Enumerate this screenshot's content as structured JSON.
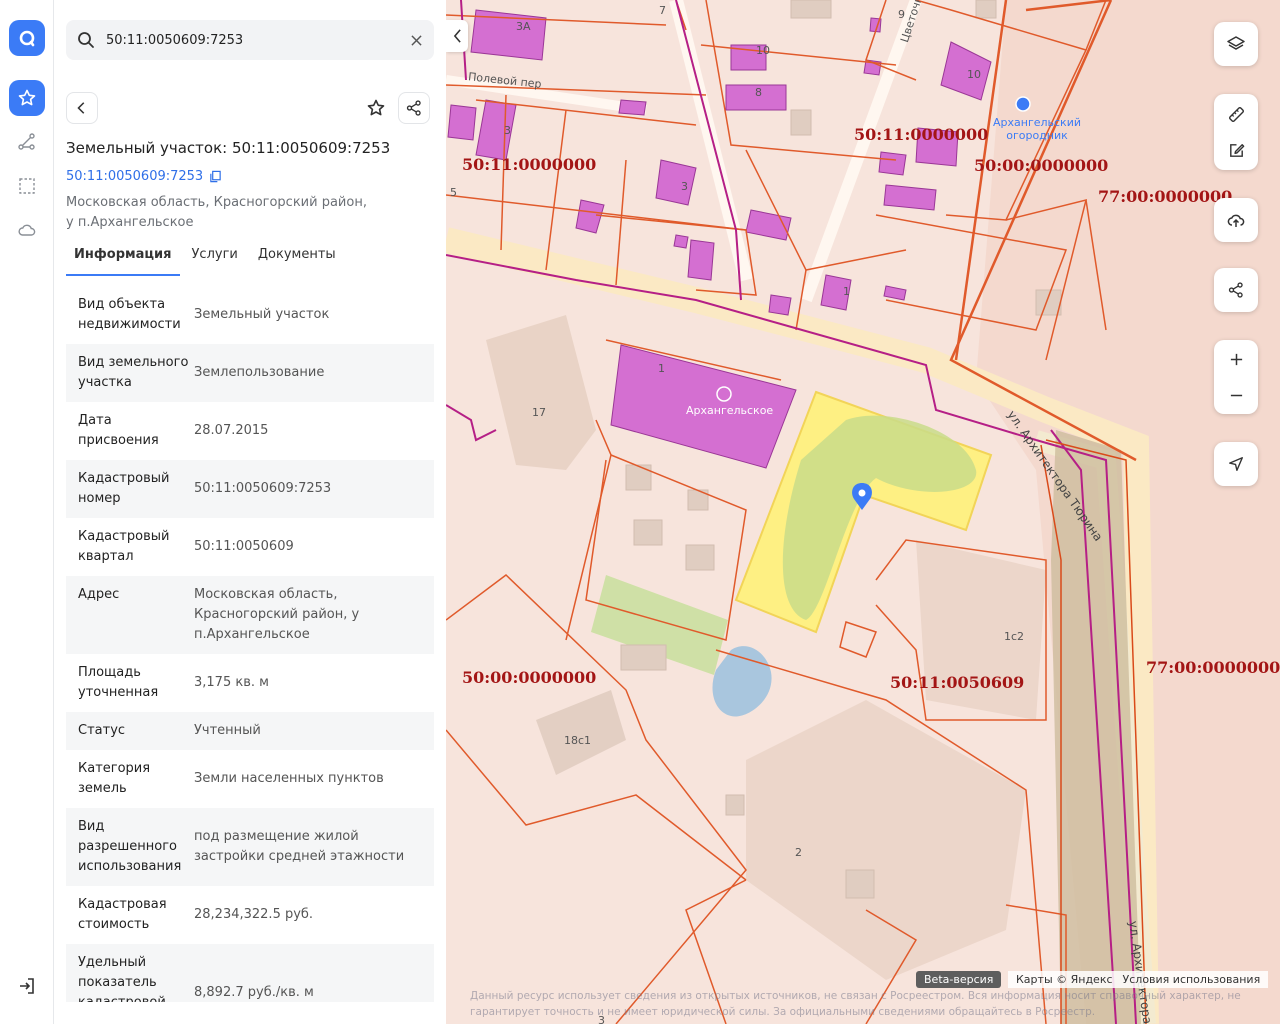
{
  "search": {
    "value": "50:11:0050609:7253"
  },
  "object": {
    "title": "Земельный участок: 50:11:0050609:7253",
    "cadastral_link": "50:11:0050609:7253",
    "address_sub": "Московская область, Красногорский район, у п.Архангельское"
  },
  "tabs": [
    "Информация",
    "Услуги",
    "Документы"
  ],
  "info": [
    {
      "k": "Вид объекта недвижимости",
      "v": "Земельный участок"
    },
    {
      "k": "Вид земельного участка",
      "v": "Землепользование"
    },
    {
      "k": "Дата присвоения",
      "v": "28.07.2015"
    },
    {
      "k": "Кадастровый номер",
      "v": "50:11:0050609:7253"
    },
    {
      "k": "Кадастровый квартал",
      "v": "50:11:0050609"
    },
    {
      "k": "Адрес",
      "v": "Московская область, Красногорский район, у п.Архангельское"
    },
    {
      "k": "Площадь уточненная",
      "v": "3,175 кв. м"
    },
    {
      "k": "Статус",
      "v": "Учтенный"
    },
    {
      "k": "Категория земель",
      "v": "Земли населенных пунктов"
    },
    {
      "k": "Вид разрешенного использования",
      "v": "под размещение жилой застройки средней этажности"
    },
    {
      "k": "Кадастровая стоимость",
      "v": "28,234,322.5 руб."
    },
    {
      "k": "Удельный показатель кадастровой стоимости",
      "v": "8,892.7 руб./кв. м"
    }
  ],
  "map": {
    "zones": [
      "50:11:0000000",
      "50:11:0000000",
      "50:00:0000000",
      "77:00:0000000",
      "50:00:0000000",
      "50:11:0050609",
      "77:00:0000000"
    ],
    "streets": [
      "Полевой пер",
      "Цветочная ул.",
      "ул. Архитектора Тюрина",
      "ул. Архитектора"
    ],
    "poi": [
      "Архангельский огородник",
      "Архангельское"
    ],
    "house_numbers": [
      "3А",
      "7",
      "9",
      "10",
      "8",
      "10",
      "3",
      "3",
      "5",
      "1",
      "1",
      "17",
      "1с2",
      "18с1",
      "2",
      "3"
    ],
    "beta": "Beta-версия",
    "attrib_maps": "Карты © Яндекс",
    "attrib_terms": "Условия использования",
    "disclaimer": "Данный ресурс использует сведения из открытых источников, не связан с Росреестром. Вся информация носит справочный характер, не гарантирует точность и не имеет юридической силы. За официальными сведениями обращайтесь в Росреестр."
  },
  "colors": {
    "accent": "#3b7bf6",
    "parcel_border": "#e05a2b",
    "building": "#d46fd1",
    "selected": "#fff27a",
    "zone_text": "#a31515"
  }
}
